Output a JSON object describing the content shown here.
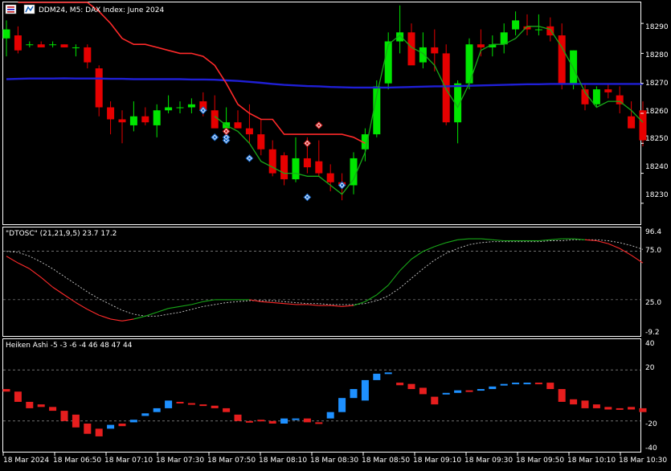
{
  "window": {
    "title": "DDM24, M5:  DAX Index: June 2024",
    "icons": [
      "menu-icon",
      "chart-icon"
    ]
  },
  "panes": {
    "main": {
      "price_ticks": [
        "18290",
        "18280",
        "18270",
        "18260",
        "18250",
        "18240",
        "18230"
      ]
    },
    "dtosc": {
      "title": "\"DTOSC\" (21,21,9,5) 23.7 17.2",
      "ticks": [
        "96.4",
        "75.0",
        "25.0",
        "-9.2"
      ]
    },
    "heiken": {
      "title": "Heiken Ashi -5 -3 -6 -4 46 48 47 44",
      "ticks": [
        "40",
        "20",
        "-20",
        "-40"
      ]
    }
  },
  "time_labels": [
    "18 Mar 2024",
    "18 Mar 06:50",
    "18 Mar 07:10",
    "18 Mar 07:30",
    "18 Mar 07:50",
    "18 Mar 08:10",
    "18 Mar 08:30",
    "18 Mar 08:50",
    "18 Mar 09:10",
    "18 Mar 09:30",
    "18 Mar 09:50",
    "18 Mar 10:10",
    "18 Mar 10:30"
  ],
  "colors": {
    "bull": "#00e600",
    "bear": "#e60000",
    "ma_blue": "#1f1fd6",
    "signal_line": "#ff2a2a",
    "green_line": "#18a818",
    "ha_up": "#1e90ff",
    "ha_down": "#e61e1e",
    "grid": "#ffffff",
    "axis": "#ffffff"
  },
  "chart_data": [
    {
      "type": "candlestick",
      "pane": "price",
      "ylim": [
        18223,
        18297
      ],
      "candles": [
        [
          18285,
          18291,
          18279,
          18288
        ],
        [
          18286,
          18289,
          18280,
          18281
        ],
        [
          18283,
          18284,
          18282,
          18283
        ],
        [
          18283,
          18284,
          18282,
          18282
        ],
        [
          18283,
          18284,
          18282,
          18283
        ],
        [
          18283,
          18283,
          18282,
          18282
        ],
        [
          18282,
          18283,
          18279,
          18282
        ],
        [
          18282,
          18283,
          18275,
          18277
        ],
        [
          18275,
          18276,
          18259,
          18262
        ],
        [
          18262,
          18264,
          18253,
          18258
        ],
        [
          18258,
          18261,
          18250,
          18257
        ],
        [
          18256,
          18264,
          18254,
          18259
        ],
        [
          18259,
          18262,
          18256,
          18257
        ],
        [
          18256,
          18263,
          18252,
          18261
        ],
        [
          18261,
          18266,
          18260,
          18262
        ],
        [
          18262,
          18264,
          18260,
          18262
        ],
        [
          18262,
          18265,
          18260,
          18263
        ],
        [
          18264,
          18267,
          18259,
          18261
        ],
        [
          18261,
          18266,
          18258,
          18255
        ],
        [
          18255,
          18262,
          18252,
          18257
        ],
        [
          18257,
          18261,
          18255,
          18255
        ],
        [
          18255,
          18263,
          18250,
          18253
        ],
        [
          18253,
          18258,
          18246,
          18248
        ],
        [
          18248,
          18251,
          18239,
          18240
        ],
        [
          18246,
          18247,
          18236,
          18238
        ],
        [
          18238,
          18252,
          18237,
          18245
        ],
        [
          18245,
          18252,
          18240,
          18242
        ],
        [
          18244,
          18251,
          18239,
          18240
        ],
        [
          18240,
          18243,
          18234,
          18237
        ],
        [
          18237,
          18240,
          18231,
          18236
        ],
        [
          18236,
          18247,
          18233,
          18245
        ],
        [
          18248,
          18255,
          18244,
          18253
        ],
        [
          18253,
          18271,
          18252,
          18269
        ],
        [
          18270,
          18287,
          18268,
          18284
        ],
        [
          18284,
          18296,
          18280,
          18287
        ],
        [
          18287,
          18290,
          18277,
          18276
        ],
        [
          18277,
          18287,
          18275,
          18282
        ],
        [
          18282,
          18288,
          18274,
          18280
        ],
        [
          18280,
          18283,
          18256,
          18257
        ],
        [
          18257,
          18271,
          18250,
          18270
        ],
        [
          18270,
          18285,
          18268,
          18283
        ],
        [
          18283,
          18288,
          18279,
          18282
        ],
        [
          18282,
          18286,
          18279,
          18283
        ],
        [
          18283,
          18290,
          18280,
          18287
        ],
        [
          18288,
          18294,
          18286,
          18291
        ],
        [
          18289,
          18293,
          18286,
          18288
        ],
        [
          18288,
          18293,
          18286,
          18288
        ],
        [
          18289,
          18292,
          18284,
          18286
        ],
        [
          18286,
          18290,
          18268,
          18270
        ],
        [
          18270,
          18281,
          18268,
          18281
        ],
        [
          18268,
          18270,
          18261,
          18263
        ],
        [
          18263,
          18269,
          18262,
          18268
        ],
        [
          18268,
          18270,
          18265,
          18267
        ],
        [
          18266,
          18269,
          18260,
          18263
        ],
        [
          18259,
          18264,
          18255,
          18255
        ],
        [
          18261,
          18264,
          18249,
          18251
        ]
      ],
      "overlays": [
        {
          "name": "blue-line",
          "values": [
            18271.4,
            18271.5,
            18271.6,
            18271.6,
            18271.6,
            18271.7,
            18271.6,
            18271.6,
            18271.6,
            18271.5,
            18271.5,
            18271.4,
            18271.4,
            18271.4,
            18271.4,
            18271.4,
            18271.3,
            18271.3,
            18271.2,
            18271.0,
            18270.8,
            18270.5,
            18270.2,
            18269.8,
            18269.5,
            18269.3,
            18269.1,
            18269.0,
            18268.8,
            18268.7,
            18268.6,
            18268.6,
            18268.6,
            18268.6,
            18268.7,
            18268.8,
            18268.9,
            18269.0,
            18269.0,
            18269.1,
            18269.2,
            18269.3,
            18269.4,
            18269.5,
            18269.6,
            18269.7,
            18269.7,
            18269.8,
            18269.8,
            18269.8,
            18269.8,
            18269.8,
            18269.8,
            18269.8,
            18269.8,
            18269.8
          ]
        },
        {
          "name": "red-step-line",
          "values": [
            null,
            18297,
            18297,
            18297,
            18297,
            18297,
            18297,
            18297,
            18294,
            18290,
            18285,
            18283,
            18283,
            18282,
            18281,
            18280,
            18280,
            18279,
            18276,
            18270,
            18263,
            18260,
            18258,
            18258,
            18253,
            18253,
            18253,
            18253,
            18253,
            18253,
            18252,
            18250,
            null,
            null,
            null,
            null,
            null,
            null,
            null,
            null,
            null,
            null,
            null,
            null,
            null,
            null,
            null,
            null,
            null,
            null,
            null,
            null,
            null,
            null,
            null,
            null
          ]
        },
        {
          "name": "green-line",
          "values": [
            null,
            null,
            null,
            null,
            null,
            null,
            null,
            null,
            null,
            null,
            null,
            null,
            null,
            null,
            null,
            null,
            null,
            null,
            18259,
            18256,
            18254,
            18250,
            18244,
            18242,
            18240,
            18240,
            18239,
            18239,
            18236,
            18233,
            18238,
            18247,
            18266,
            18283,
            18286,
            18282,
            18280,
            18276,
            18268,
            18262,
            18270,
            18281,
            18283,
            18283,
            18285,
            18289,
            18289,
            18288,
            18282,
            18275,
            18267,
            18262,
            18264,
            18264,
            18261,
            18257
          ]
        }
      ],
      "markers": [
        {
          "kind": "up-arrow",
          "at": 17,
          "value": 18261
        },
        {
          "kind": "up-arrow",
          "at": 18,
          "value": 18252
        },
        {
          "kind": "up-arrow",
          "at": 19,
          "value": 18251
        },
        {
          "kind": "up-arrow",
          "at": 19,
          "value": 18252
        },
        {
          "kind": "up-arrow",
          "at": 21,
          "value": 18245
        },
        {
          "kind": "up-arrow",
          "at": 26,
          "value": 18232
        },
        {
          "kind": "up-arrow",
          "at": 29,
          "value": 18236
        },
        {
          "kind": "down-arrow",
          "at": 19,
          "value": 18254
        },
        {
          "kind": "down-arrow",
          "at": 26,
          "value": 18250
        },
        {
          "kind": "down-arrow",
          "at": 27,
          "value": 18256
        }
      ]
    },
    {
      "type": "line",
      "pane": "dtosc",
      "ylim": [
        -9.2,
        96.4
      ],
      "levels": [
        75,
        25
      ],
      "series": [
        {
          "values": [
            70,
            63,
            57,
            48,
            38,
            30,
            22,
            15,
            9,
            5,
            3,
            5,
            8,
            12,
            16,
            18,
            20,
            23,
            25,
            25,
            25,
            25,
            23,
            22,
            21,
            20,
            20,
            19,
            19,
            18,
            19,
            23,
            30,
            40,
            55,
            67,
            75,
            80,
            84,
            87,
            88,
            88,
            87,
            86,
            86,
            86,
            86,
            87,
            88,
            88,
            87,
            86,
            83,
            78,
            71,
            63
          ]
        },
        {
          "values": [
            75,
            74,
            70,
            64,
            57,
            49,
            41,
            33,
            26,
            20,
            14,
            10,
            8,
            8,
            10,
            12,
            15,
            18,
            20,
            22,
            23,
            24,
            24,
            24,
            23,
            22,
            21,
            21,
            20,
            20,
            20,
            21,
            24,
            29,
            37,
            47,
            57,
            66,
            73,
            78,
            82,
            84,
            85,
            85,
            85,
            85,
            85,
            86,
            86,
            87,
            87,
            87,
            86,
            84,
            81,
            77
          ]
        }
      ]
    },
    {
      "type": "bar",
      "pane": "heiken",
      "ylim": [
        -44,
        44
      ],
      "levels": [
        20,
        -20
      ],
      "bars": [
        [
          5,
          3
        ],
        [
          3,
          -5
        ],
        [
          -5,
          -10
        ],
        [
          -7,
          -9
        ],
        [
          -9,
          -12
        ],
        [
          -12,
          -20
        ],
        [
          -15,
          -25
        ],
        [
          -22,
          -30
        ],
        [
          -26,
          -32
        ],
        [
          -26,
          -23
        ],
        [
          -22,
          -24
        ],
        [
          -21,
          -19
        ],
        [
          -16,
          -14
        ],
        [
          -13,
          -10
        ],
        [
          -10,
          -4
        ],
        [
          -5,
          -6
        ],
        [
          -6,
          -7
        ],
        [
          -7,
          -8
        ],
        [
          -8,
          -10
        ],
        [
          -10,
          -13
        ],
        [
          -15,
          -20
        ],
        [
          -20,
          -21
        ],
        [
          -19,
          -20
        ],
        [
          -20,
          -22
        ],
        [
          -22,
          -18
        ],
        [
          -18,
          -18
        ],
        [
          -18,
          -21
        ],
        [
          -21,
          -22
        ],
        [
          -18,
          -13
        ],
        [
          -13,
          -2
        ],
        [
          -2,
          5
        ],
        [
          -4,
          12
        ],
        [
          12,
          17
        ],
        [
          17,
          18
        ],
        [
          10,
          8
        ],
        [
          9,
          5
        ],
        [
          6,
          1
        ],
        [
          -1,
          -7
        ],
        [
          1,
          2
        ],
        [
          2,
          4
        ],
        [
          4,
          3
        ],
        [
          4,
          5
        ],
        [
          5,
          7
        ],
        [
          8,
          9
        ],
        [
          9,
          10
        ],
        [
          9,
          10
        ],
        [
          10,
          9
        ],
        [
          10,
          5
        ],
        [
          5,
          -5
        ],
        [
          -3,
          -7
        ],
        [
          -4,
          -10
        ],
        [
          -7,
          -10
        ],
        [
          -9,
          -11
        ],
        [
          -10,
          -11
        ],
        [
          -9,
          -11
        ],
        [
          -10,
          -13
        ]
      ]
    }
  ]
}
